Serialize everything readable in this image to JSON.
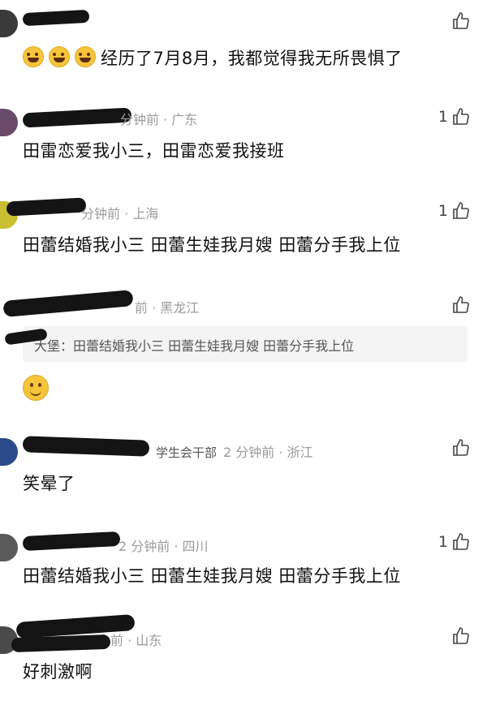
{
  "comments": [
    {
      "meta": "",
      "text": "经历了7月8月，我都觉得我无所畏惧了",
      "likes": ""
    },
    {
      "meta": "分钟前 · 广东",
      "text": "田雷恋爱我小三，田雷恋爱我接班",
      "likes": "1"
    },
    {
      "meta": "分钟前 · 上海",
      "text": "田蕾结婚我小三 田蕾生娃我月嫂 田蕾分手我上位",
      "likes": "1"
    },
    {
      "meta": "前 · 黑龙江",
      "quote": "大堡：田蕾结婚我小三 田蕾生娃我月嫂 田蕾分手我上位",
      "likes": ""
    },
    {
      "badge": "学生会干部",
      "meta": "2 分钟前 · 浙江",
      "text": "笑晕了",
      "likes": ""
    },
    {
      "meta": "2 分钟前 · 四川",
      "text": "田蕾结婚我小三 田蕾生娃我月嫂 田蕾分手我上位",
      "likes": "1"
    },
    {
      "meta": "前 · 山东",
      "text": "好刺激啊",
      "likes": ""
    }
  ],
  "icons": {
    "like": "thumbs-up-icon",
    "laugh": "laughing-tears-emoji",
    "smile": "smiley-emoji"
  }
}
